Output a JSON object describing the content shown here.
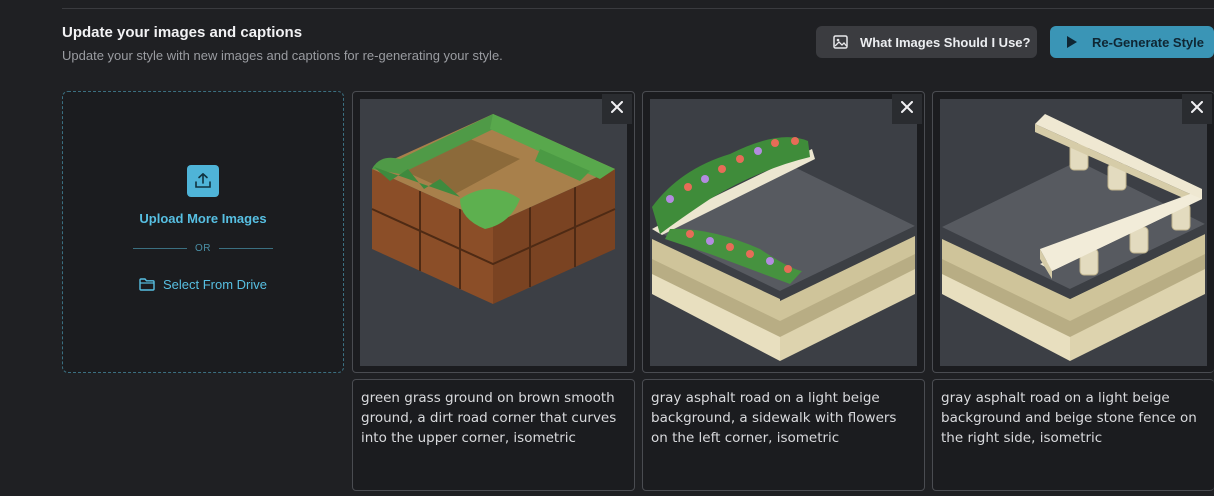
{
  "section": {
    "title": "Update your images and captions",
    "subtitle": "Update your style with new images and captions for re-generating your style."
  },
  "buttons": {
    "what_images": "What Images Should I Use?",
    "regenerate": "Re-Generate Style"
  },
  "upload": {
    "upload_label": "Upload More Images",
    "or": "OR",
    "drive_label": "Select From Drive"
  },
  "cards": [
    {
      "image_name": "grass-dirt-block-image",
      "caption": "green grass ground on brown smooth ground,  a dirt road corner that curves into the upper corner, isometric"
    },
    {
      "image_name": "asphalt-flowers-image",
      "caption": "gray asphalt road on a light beige background, a sidewalk with flowers on the left corner, isometric"
    },
    {
      "image_name": "asphalt-fence-image",
      "caption": "gray asphalt road on a light beige background and beige stone fence on the right side, isometric"
    }
  ],
  "colors": {
    "accent": "#3a95b6",
    "link": "#57bfe2",
    "background": "#1f2023"
  },
  "icons": [
    "image-icon",
    "play-icon",
    "upload-icon",
    "folder-icon",
    "close-icon"
  ]
}
